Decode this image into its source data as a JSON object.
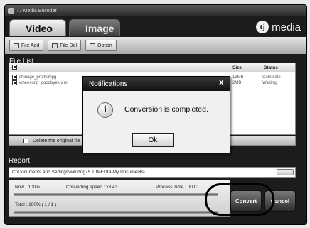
{
  "window": {
    "title": "TJ Media Encoder"
  },
  "tabs": [
    {
      "label": "Video",
      "active": true
    },
    {
      "label": "Image",
      "active": false
    }
  ],
  "brand": {
    "logo": "tj",
    "name": "media"
  },
  "toolbar": {
    "file_add": "File Add",
    "file_del": "File Del",
    "option": "Option"
  },
  "file_list": {
    "title": "File List",
    "columns": {
      "size": "Size",
      "status": "Status"
    },
    "rows": [
      {
        "name": "shinago_pretty.mpg",
        "size": "13MB",
        "status": "Complete",
        "checked": true
      },
      {
        "name": "wheesung_goodbyeluv.m",
        "size": "2MB",
        "status": "Waiting",
        "checked": true
      }
    ],
    "delete_original": "Delete the original file"
  },
  "report": {
    "title": "Report",
    "path": "C:\\Documents and Settings\\wilddog75.TJMEDIA\\My Documents\\",
    "now_label": "Now : 100%",
    "speed_label": "Converting speed : x3.43",
    "process_time_label": "Process Time : 00:01",
    "total_label": "Total : 100%   ( 1 / 1 )",
    "now_progress": 1.0,
    "total_progress": 1.0
  },
  "buttons": {
    "convert": "Convert",
    "cancel": "Cancel"
  },
  "dialog": {
    "title": "Notifications",
    "close": "X",
    "icon": "info-icon",
    "message": "Conversion is completed.",
    "ok": "Ok"
  }
}
